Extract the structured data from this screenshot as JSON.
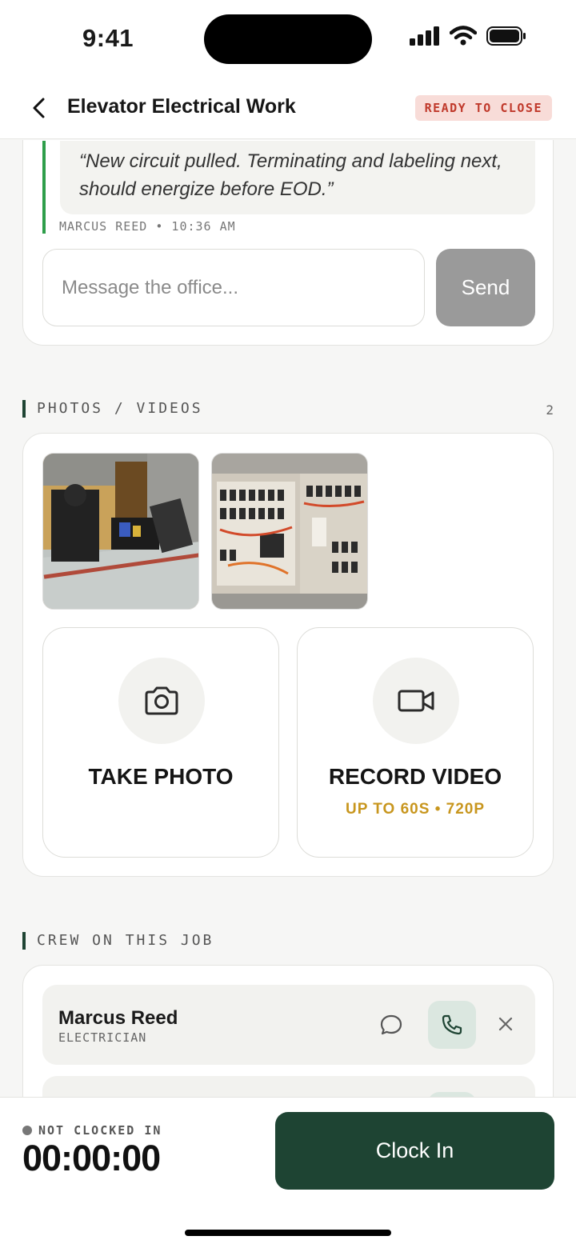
{
  "status_bar": {
    "time": "9:41"
  },
  "header": {
    "title": "Elevator Electrical Work",
    "status_badge": "READY TO CLOSE"
  },
  "messages": {
    "last_message": "“New circuit pulled. Terminating and labeling next, should energize before EOD.”",
    "meta": "MARCUS REED • 10:36 AM",
    "input_placeholder": "Message the office...",
    "send_label": "Send"
  },
  "media": {
    "section_title": "PHOTOS / VIDEOS",
    "count": "2",
    "take_photo_label": "TAKE PHOTO",
    "record_video_label": "RECORD VIDEO",
    "record_video_sub": "UP TO 60S • 720P"
  },
  "crew": {
    "section_title": "CREW ON THIS JOB",
    "members": [
      {
        "name": "Marcus Reed",
        "role": "ELECTRICIAN"
      }
    ]
  },
  "footer": {
    "clock_status": "NOT CLOCKED IN",
    "timer": "00:00:00",
    "clock_in_label": "Clock In"
  },
  "colors": {
    "brand_dark_green": "#1e4433",
    "badge_red": "#c0392b",
    "accent_gold": "#c8961e",
    "quote_green": "#2e9e4a"
  },
  "icons": [
    "back-chevron-icon",
    "signal-icon",
    "wifi-icon",
    "battery-icon",
    "camera-icon",
    "video-camera-icon",
    "chat-bubble-icon",
    "phone-icon",
    "close-icon"
  ]
}
